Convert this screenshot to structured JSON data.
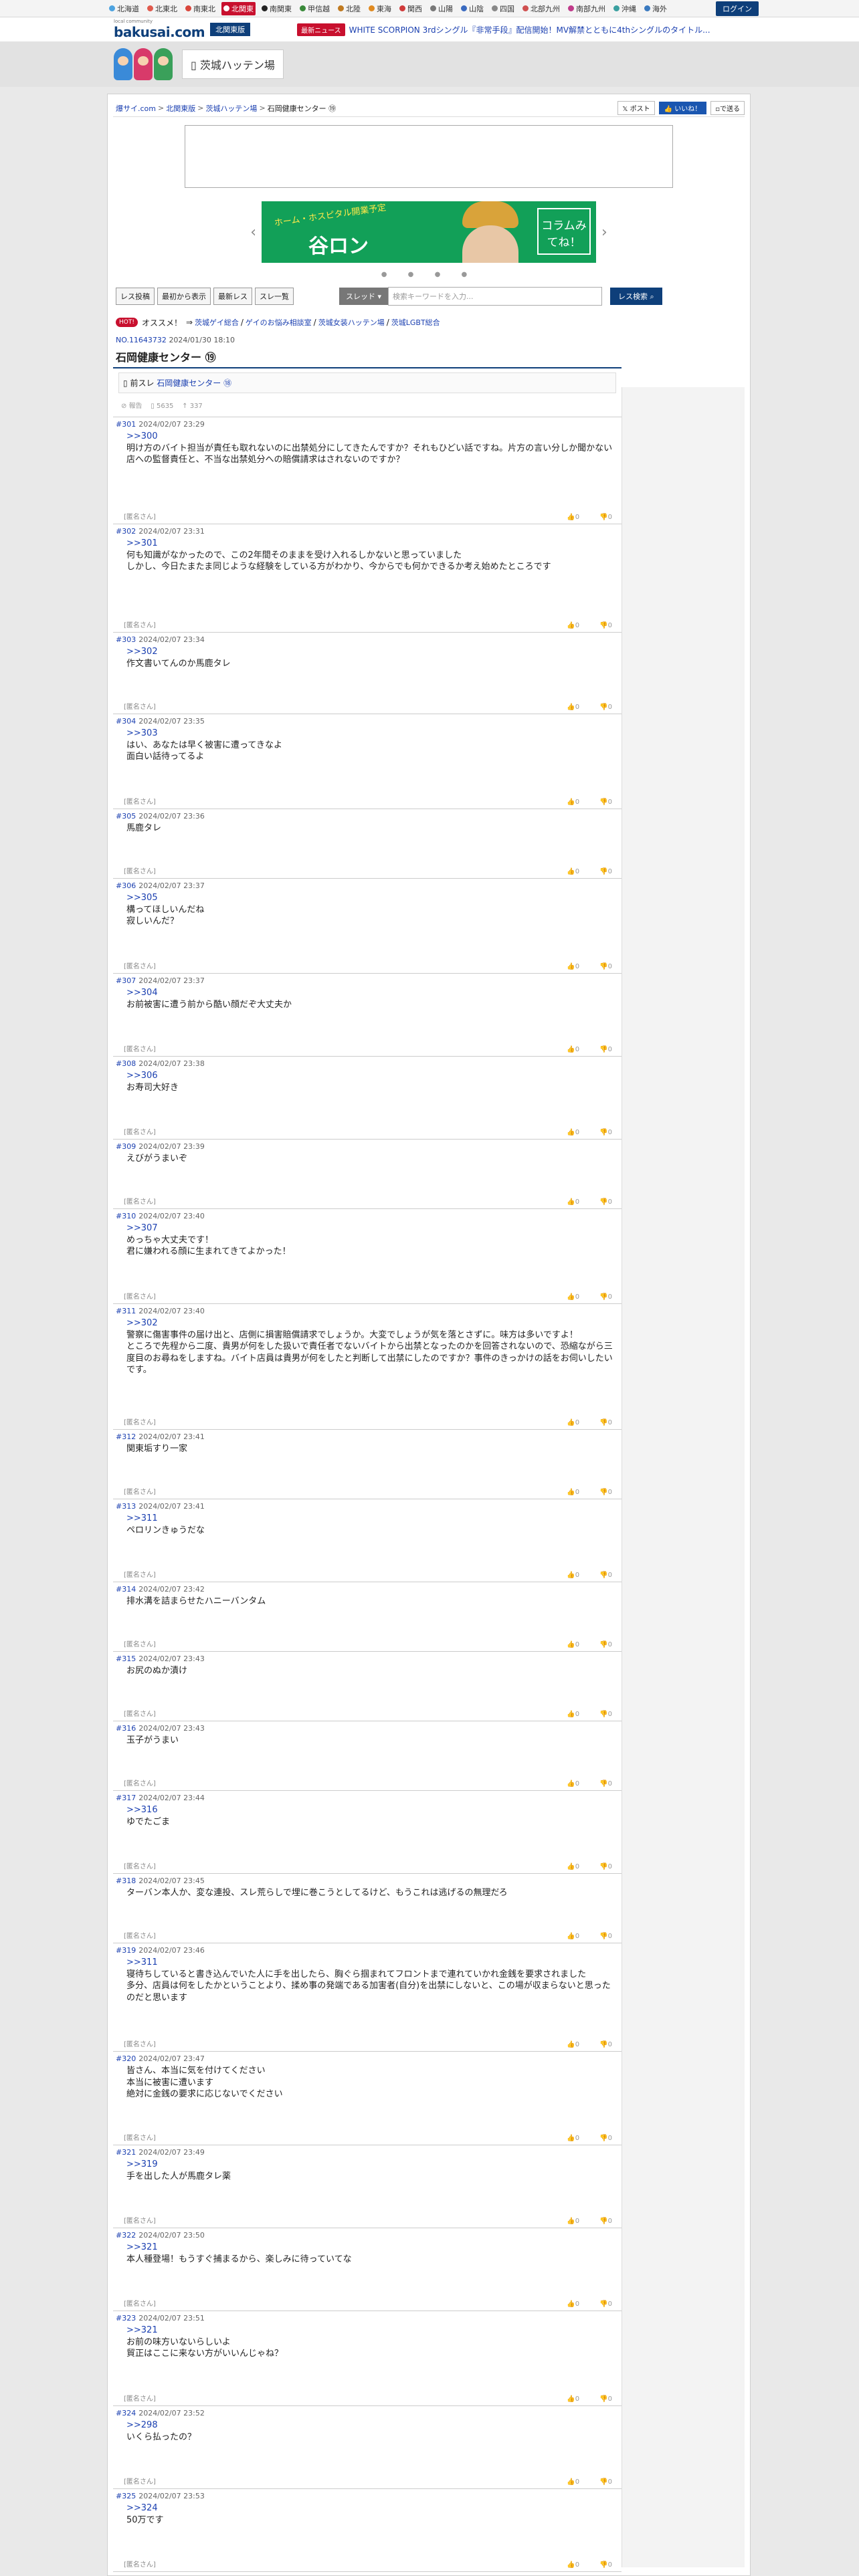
{
  "topnav": {
    "regions": [
      {
        "label": "北海道",
        "color": "#4da3e0"
      },
      {
        "label": "北東北",
        "color": "#e05a4d"
      },
      {
        "label": "南東北",
        "color": "#d9463c"
      },
      {
        "label": "北関東",
        "color": "#c8102e",
        "active": true
      },
      {
        "label": "南関東",
        "color": "#222222"
      },
      {
        "label": "甲信越",
        "color": "#3a8a3a"
      },
      {
        "label": "北陸",
        "color": "#c07a20"
      },
      {
        "label": "東海",
        "color": "#e08a20"
      },
      {
        "label": "関西",
        "color": "#d03a3a"
      },
      {
        "label": "山陽",
        "color": "#777777"
      },
      {
        "label": "山陰",
        "color": "#3a6ac0"
      },
      {
        "label": "四国",
        "color": "#888888"
      },
      {
        "label": "北部九州",
        "color": "#d05050"
      },
      {
        "label": "南部九州",
        "color": "#c03a8a"
      },
      {
        "label": "沖縄",
        "color": "#3aa0a0"
      },
      {
        "label": "海外",
        "color": "#3a7ac0"
      }
    ],
    "login": "ログイン"
  },
  "logobar": {
    "logo_small": "local community",
    "logo_main": "bakusai.com",
    "area": "北関東版",
    "news_badge": "最新ニュース",
    "news_text": "WHITE SCORPION 3rdシングル『非常手段』配信開始！MV解禁とともに4thシングルのタイトル..."
  },
  "board": {
    "tab": "茨城ハッテン場"
  },
  "breadcrumb": {
    "items": [
      "爆サイ.com",
      "北関東版",
      "茨城ハッテン場",
      "石岡健康センター ⑲"
    ],
    "post_label": "ポスト",
    "like_label": "いいね！",
    "send_label": "で送る"
  },
  "banner": {
    "title": "谷ロン",
    "sub": "ホーム・ホスピタル開業予定",
    "column": "コラムみてね！"
  },
  "toolbar": {
    "buttons": [
      "レス投稿",
      "最初から表示",
      "最新レス",
      "スレ一覧"
    ],
    "select": "スレッド",
    "search_placeholder": "検索キーワードを入力...",
    "search_button": "レス検索"
  },
  "recommend": {
    "hot": "HOT!",
    "label": "オススメ！",
    "links": [
      "茨城ゲイ総合",
      "ゲイのお悩み相談室",
      "茨城女装ハッテン場",
      "茨城LGBT総合"
    ]
  },
  "thread": {
    "number": "NO.11643732",
    "date": "2024/01/30 18:10",
    "title": "石岡健康センター ⑲",
    "prev_label": "前スレ",
    "prev_link": "石岡健康センター ⑱",
    "report": "報告",
    "views": "5635",
    "shares": "337"
  },
  "posts": [
    {
      "num": "#301",
      "date": "2024/02/07 23:29",
      "anchor": ">>300",
      "text": "明け方のバイト担当が責任も取れないのに出禁処分にしてきたんですか？それもひどい話ですね。片方の言い分しか聞かない店への監督責任と、不当な出禁処分への賠償請求はされないのですか？",
      "name": "[匿名さん]",
      "h": 160
    },
    {
      "num": "#302",
      "date": "2024/02/07 23:31",
      "anchor": ">>301",
      "text": "何も知識がなかったので、この2年間そのままを受け入れるしかないと思っていました\nしかし、今日たまたま同じような経験をしている方がわかり、今からでも何かできるか考え始めたところです",
      "name": "[匿名さん]",
      "h": 162
    },
    {
      "num": "#303",
      "date": "2024/02/07 23:34",
      "anchor": ">>302",
      "text": "作文書いてんのか馬鹿タレ",
      "name": "[匿名さん]",
      "h": 122
    },
    {
      "num": "#304",
      "date": "2024/02/07 23:35",
      "anchor": ">>303",
      "text": "はい、あなたは早く被害に遭ってきなよ\n面白い話待ってるよ",
      "name": "[匿名さん]",
      "h": 142
    },
    {
      "num": "#305",
      "date": "2024/02/07 23:36",
      "anchor": "",
      "text": "馬鹿タレ",
      "name": "[匿名さん]",
      "h": 104
    },
    {
      "num": "#306",
      "date": "2024/02/07 23:37",
      "anchor": ">>305",
      "text": "構ってほしいんだね\n寂しいんだ？",
      "name": "[匿名さん]",
      "h": 142
    },
    {
      "num": "#307",
      "date": "2024/02/07 23:37",
      "anchor": ">>304",
      "text": "お前被害に遭う前から酷い顔だぞ大丈夫か",
      "name": "[匿名さん]",
      "h": 124
    },
    {
      "num": "#308",
      "date": "2024/02/07 23:38",
      "anchor": ">>306",
      "text": "お寿司大好き",
      "name": "[匿名さん]",
      "h": 124
    },
    {
      "num": "#309",
      "date": "2024/02/07 23:39",
      "anchor": "",
      "text": "えびがうまいぞ",
      "name": "[匿名さん]",
      "h": 104
    },
    {
      "num": "#310",
      "date": "2024/02/07 23:40",
      "anchor": ">>307",
      "text": "めっちゃ大丈夫です！\n君に嫌われる顔に生まれてきてよかった！",
      "name": "[匿名さん]",
      "h": 142
    },
    {
      "num": "#311",
      "date": "2024/02/07 23:40",
      "anchor": ">>302",
      "text": "警察に傷害事件の届け出と、店側に損害賠償請求でしょうか。大変でしょうが気を落とさずに。味方は多いですよ！\nところで先程から二度、貴男が何をした扱いで責任者でないバイトから出禁となったのかを回答されないので、恐縮ながら三度目のお尋ねをしますね。バイト店員は貴男が何をしたと判断して出禁にしたのですか？事件のきっかけの話をお伺いしたいです。",
      "name": "[匿名さん]",
      "h": 188
    },
    {
      "num": "#312",
      "date": "2024/02/07 23:41",
      "anchor": "",
      "text": "関東垢すり一家",
      "name": "[匿名さん]",
      "h": 104
    },
    {
      "num": "#313",
      "date": "2024/02/07 23:41",
      "anchor": ">>311",
      "text": "ペロリンきゅうだな",
      "name": "[匿名さん]",
      "h": 124
    },
    {
      "num": "#314",
      "date": "2024/02/07 23:42",
      "anchor": "",
      "text": "排水溝を詰まらせたハニーバンタム",
      "name": "[匿名さん]",
      "h": 104
    },
    {
      "num": "#315",
      "date": "2024/02/07 23:43",
      "anchor": "",
      "text": "お尻のぬか漬け",
      "name": "[匿名さん]",
      "h": 104
    },
    {
      "num": "#316",
      "date": "2024/02/07 23:43",
      "anchor": "",
      "text": "玉子がうまい",
      "name": "[匿名さん]",
      "h": 104
    },
    {
      "num": "#317",
      "date": "2024/02/07 23:44",
      "anchor": ">>316",
      "text": "ゆでたごま",
      "name": "[匿名さん]",
      "h": 124
    },
    {
      "num": "#318",
      "date": "2024/02/07 23:45",
      "anchor": "",
      "text": "ターバン本人か、変な連投、スレ荒らしで埋に巻こうとしてるけど、もうこれは逃げるの無理だろ",
      "name": "[匿名さん]",
      "h": 104
    },
    {
      "num": "#319",
      "date": "2024/02/07 23:46",
      "anchor": ">>311",
      "text": "寝待ちしていると書き込んでいた人に手を出したら、胸ぐら掴まれてフロントまで連れていかれ金銭を要求されました\n多分、店員は何をしたかということより、揉め事の発端である加害者(自分)を出禁にしないと、この場が収まらないと思ったのだと思います",
      "name": "[匿名さん]",
      "h": 162
    },
    {
      "num": "#320",
      "date": "2024/02/07 23:47",
      "anchor": "",
      "text": "皆さん、本当に気を付けてください\n本当に被害に遭います\n絶対に金銭の要求に応じないでください",
      "name": "[匿名さん]",
      "h": 140
    },
    {
      "num": "#321",
      "date": "2024/02/07 23:49",
      "anchor": ">>319",
      "text": "手を出した人が馬鹿タレ薬",
      "name": "[匿名さん]",
      "h": 124
    },
    {
      "num": "#322",
      "date": "2024/02/07 23:50",
      "anchor": ">>321",
      "text": "本人種登場！もうすぐ捕まるから、楽しみに待っていてな",
      "name": "[匿名さん]",
      "h": 124
    },
    {
      "num": "#323",
      "date": "2024/02/07 23:51",
      "anchor": ">>321",
      "text": "お前の味方いないらしいよ\n貿正はここに来ない方がいいんじゃね？",
      "name": "[匿名さん]",
      "h": 142
    },
    {
      "num": "#324",
      "date": "2024/02/07 23:52",
      "anchor": ">>298",
      "text": "いくら払ったの？",
      "name": "[匿名さん]",
      "h": 124
    },
    {
      "num": "#325",
      "date": "2024/02/07 23:53",
      "anchor": ">>324",
      "text": "50万です",
      "name": "[匿名さん]",
      "h": 124
    }
  ],
  "vote_labels": [
    "0",
    "0"
  ]
}
